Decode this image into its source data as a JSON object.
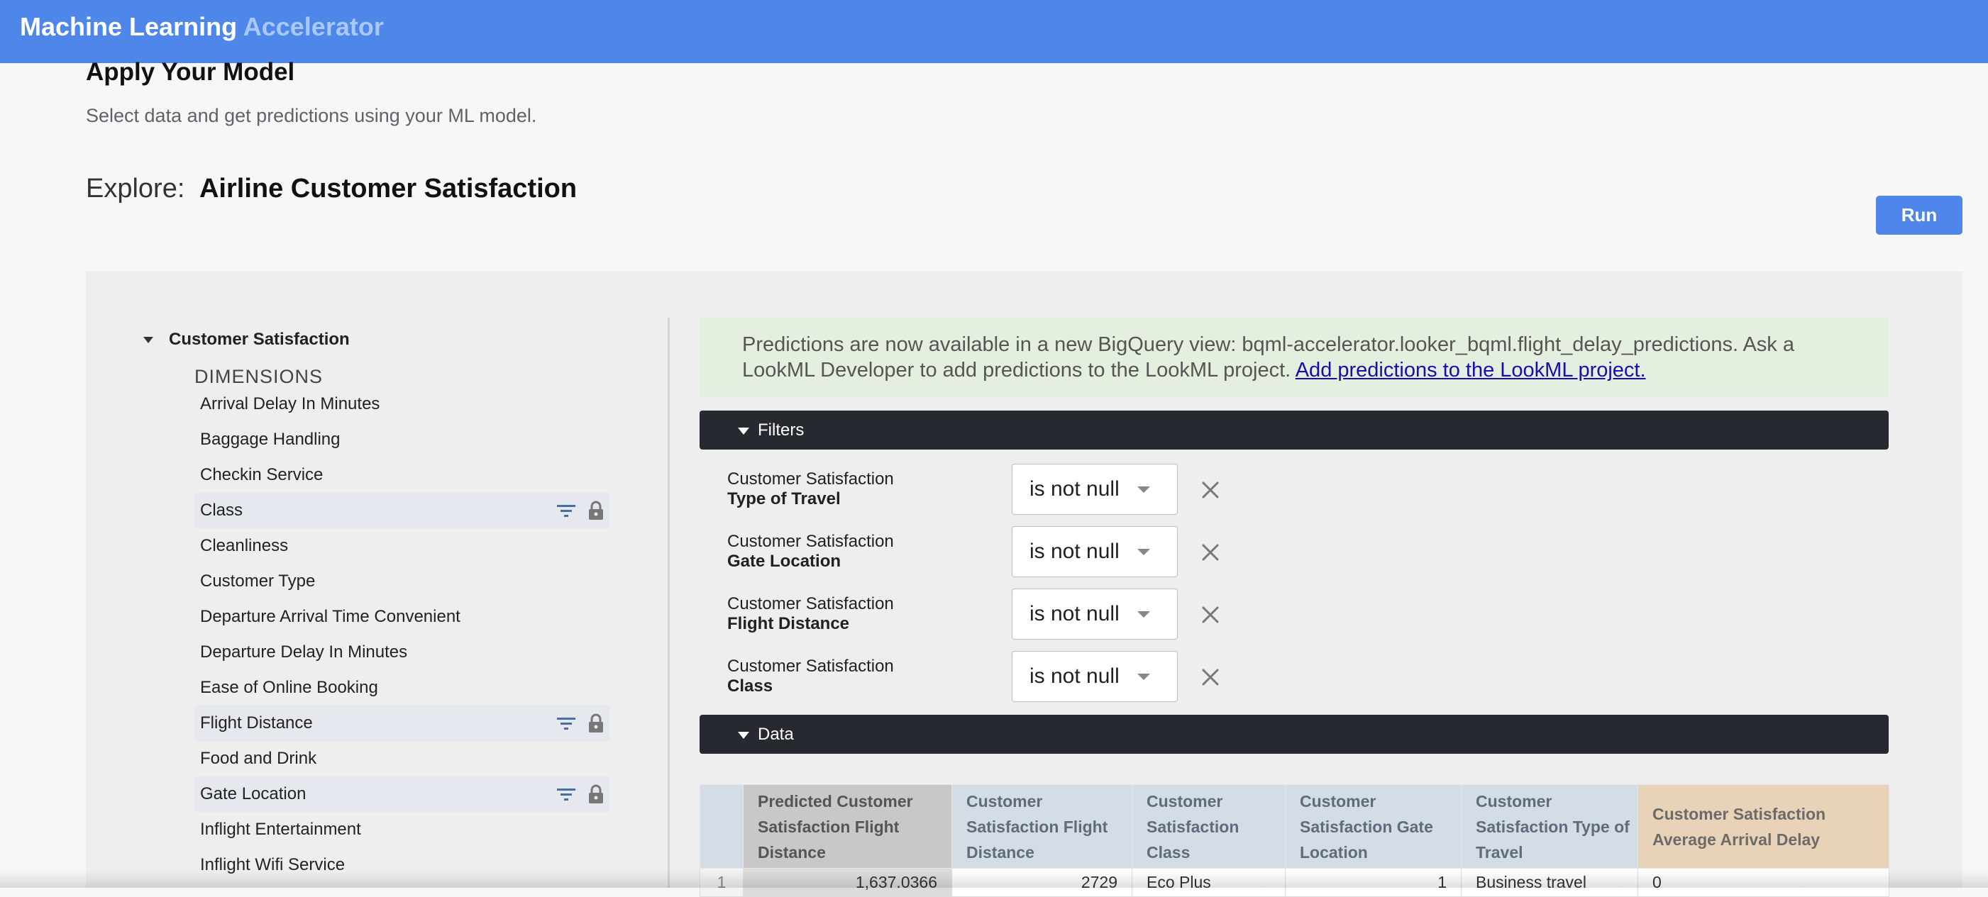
{
  "app": {
    "title_main": "Machine Learning",
    "title_accent": "Accelerator"
  },
  "page": {
    "title": "Apply Your Model",
    "subtitle": "Select data and get predictions using your ML model.",
    "explore_label": "Explore:",
    "explore_name": "Airline Customer Satisfaction",
    "run_label": "Run"
  },
  "field_picker": {
    "view_name": "Customer Satisfaction",
    "dimensions_label": "DIMENSIONS",
    "fields": [
      {
        "label": "Arrival Delay In Minutes",
        "active": false
      },
      {
        "label": "Baggage Handling",
        "active": false
      },
      {
        "label": "Checkin Service",
        "active": false
      },
      {
        "label": "Class",
        "active": true
      },
      {
        "label": "Cleanliness",
        "active": false
      },
      {
        "label": "Customer Type",
        "active": false
      },
      {
        "label": "Departure Arrival Time Convenient",
        "active": false
      },
      {
        "label": "Departure Delay In Minutes",
        "active": false
      },
      {
        "label": "Ease of Online Booking",
        "active": false
      },
      {
        "label": "Flight Distance",
        "active": true
      },
      {
        "label": "Food and Drink",
        "active": false
      },
      {
        "label": "Gate Location",
        "active": true
      },
      {
        "label": "Inflight Entertainment",
        "active": false
      },
      {
        "label": "Inflight Wifi Service",
        "active": false
      }
    ],
    "icons": {
      "filter": "filter-icon",
      "lock": "lock-icon"
    }
  },
  "banner": {
    "text": "Predictions are now available in a new BigQuery view: bqml-accelerator.looker_bqml.flight_delay_predictions. Ask a LookML Developer to add predictions to the LookML project.",
    "link_text": "Add predictions to the LookML project."
  },
  "filters_section": {
    "title": "Filters",
    "items": [
      {
        "view": "Customer Satisfaction",
        "field": "Type of Travel",
        "operator": "is not null"
      },
      {
        "view": "Customer Satisfaction",
        "field": "Gate Location",
        "operator": "is not null"
      },
      {
        "view": "Customer Satisfaction",
        "field": "Flight Distance",
        "operator": "is not null"
      },
      {
        "view": "Customer Satisfaction",
        "field": "Class",
        "operator": "is not null"
      }
    ]
  },
  "data_section": {
    "title": "Data",
    "columns": [
      "Predicted Customer Satisfaction Flight Distance",
      "Customer Satisfaction Flight Distance",
      "Customer Satisfaction Class",
      "Customer Satisfaction Gate Location",
      "Customer Satisfaction Type of Travel",
      "Customer Satisfaction Average Arrival Delay"
    ],
    "rows": [
      {
        "n": "1",
        "cells": [
          "1,637.0366",
          "2729",
          "Eco Plus",
          "1",
          "Business travel",
          "0"
        ]
      }
    ]
  },
  "colors": {
    "header_bar": "#4f86ea",
    "run_button": "#4f86ea",
    "banner_bg": "#e4efdf",
    "section_bar": "#262a30",
    "dimension_header": "#d4dde6",
    "prediction_header": "#c8c8c8",
    "measure_header": "#e8d3b8"
  }
}
